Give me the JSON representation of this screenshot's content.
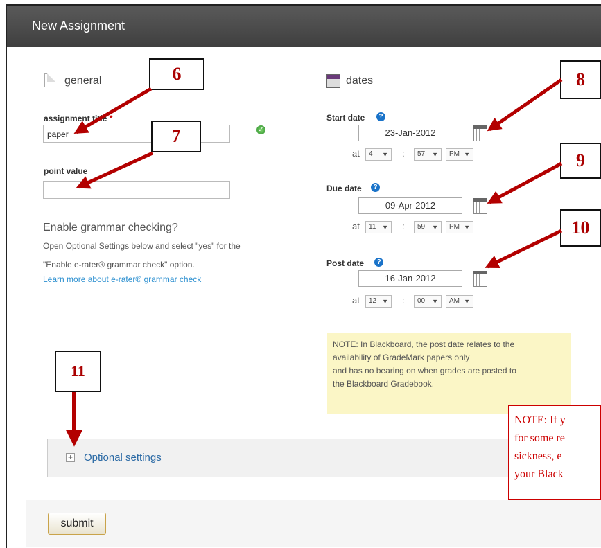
{
  "window": {
    "title": "New Assignment"
  },
  "general": {
    "section_title": "general",
    "assignment_title_label": "assignment title",
    "assignment_title_value": "paper",
    "point_value_label": "point value",
    "point_value_value": "",
    "grammar_heading": "Enable grammar checking?",
    "grammar_line1": "Open Optional Settings below and select \"yes\" for the",
    "grammar_line2": "\"Enable e-rater® grammar check\" option.",
    "grammar_link": "Learn more about e-rater® grammar check"
  },
  "dates": {
    "section_title": "dates",
    "at_label": "at",
    "colon": ":",
    "start": {
      "label": "Start date",
      "date": "23-Jan-2012",
      "hour": "4",
      "minute": "57",
      "ampm": "PM"
    },
    "due": {
      "label": "Due date",
      "date": "09-Apr-2012",
      "hour": "11",
      "minute": "59",
      "ampm": "PM"
    },
    "post": {
      "label": "Post date",
      "date": "16-Jan-2012",
      "hour": "12",
      "minute": "00",
      "ampm": "AM"
    },
    "note_lines": [
      "NOTE: In Blackboard, the post date relates to the",
      "availability of GradeMark papers only",
      "and has no bearing on when grades are posted to",
      "the Blackboard Gradebook."
    ]
  },
  "optional_settings": {
    "label": "Optional settings"
  },
  "submit_label": "submit",
  "callouts": [
    "6",
    "7",
    "8",
    "9",
    "10",
    "11"
  ],
  "red_note_lines": [
    "NOTE: If y",
    "for some re",
    "sickness, e",
    "your Black"
  ],
  "colors": {
    "arrow": "#b30000",
    "link": "#2b8fd0",
    "note_bg": "#fbf6c6",
    "callout_text": "#a00000"
  }
}
